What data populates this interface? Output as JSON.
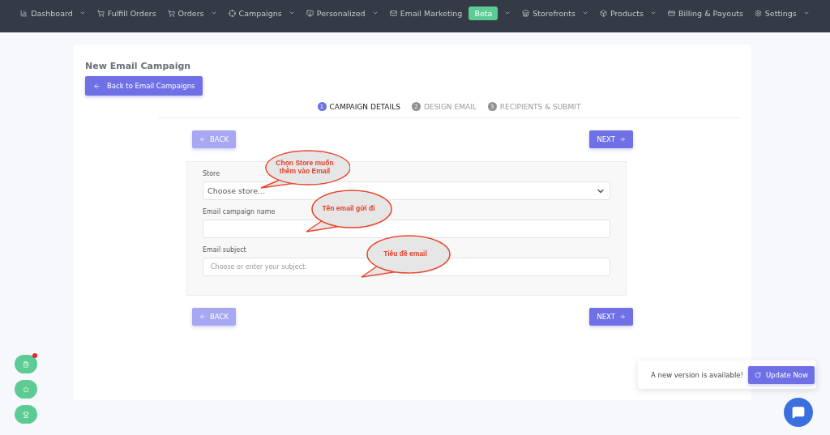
{
  "nav": [
    {
      "label": "Dashboard",
      "has_menu": true
    },
    {
      "label": "Fulfill Orders",
      "has_menu": false
    },
    {
      "label": "Orders",
      "has_menu": true
    },
    {
      "label": "Campaigns",
      "has_menu": true
    },
    {
      "label": "Personalized",
      "has_menu": true
    },
    {
      "label": "Email Marketing",
      "has_menu": true,
      "badge": "Beta"
    },
    {
      "label": "Storefronts",
      "has_menu": true
    },
    {
      "label": "Products",
      "has_menu": true
    },
    {
      "label": "Billing & Payouts",
      "has_menu": false
    },
    {
      "label": "Settings",
      "has_menu": true
    }
  ],
  "page": {
    "title": "New Email Campaign",
    "back_button": "Back to Email Campaigns"
  },
  "steps": [
    {
      "number": "1",
      "label": "CAMPAIGN DETAILS",
      "selected": true
    },
    {
      "number": "2",
      "label": "DESIGN EMAIL",
      "selected": false
    },
    {
      "number": "3",
      "label": "RECIPIENTS & SUBMIT",
      "selected": false
    }
  ],
  "nav_buttons": [
    {
      "back": "BACK",
      "next": "NEXT",
      "back_disabled": true
    },
    {
      "back": "BACK",
      "next": "NEXT",
      "back_disabled": true
    }
  ],
  "form": {
    "fields": [
      {
        "kind": "select",
        "label": "Store",
        "value": "Choose store..."
      },
      {
        "kind": "text",
        "label": "Email campaign name"
      },
      {
        "kind": "text",
        "label": "Email subject",
        "placeholder": "Choose or enter your subject."
      }
    ]
  },
  "callouts": [
    {
      "text": "Chọn Store muốn thêm vào Email"
    },
    {
      "text": "Tên email gửi đi"
    },
    {
      "text": "Tiêu đề email"
    }
  ],
  "side_buttons": [
    {
      "has_dot": true
    },
    {
      "has_dot": false
    },
    {
      "has_dot": false
    }
  ],
  "toast": {
    "text": "A new version is available!",
    "button": "Update Now"
  }
}
